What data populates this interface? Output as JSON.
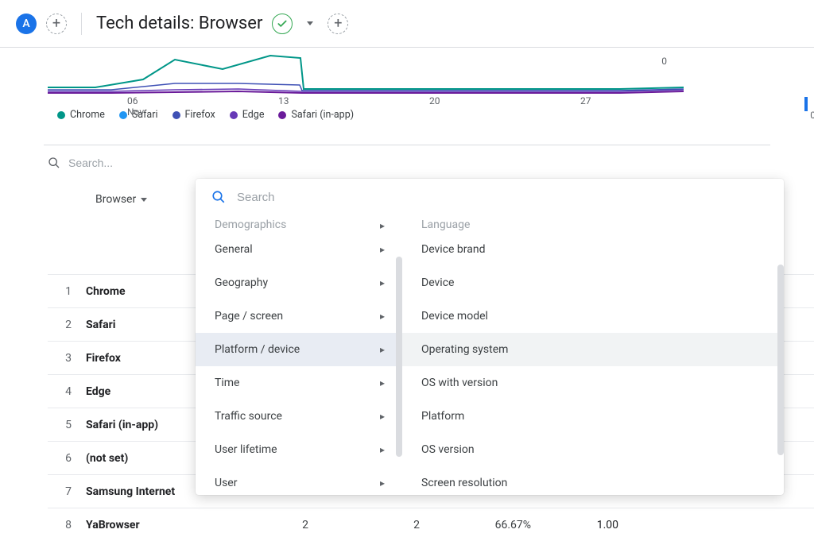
{
  "header": {
    "badge": "A",
    "title": "Tech details: Browser"
  },
  "chart": {
    "y0": "0",
    "y0_right": "0",
    "xticks": [
      "06",
      "13",
      "20",
      "27"
    ],
    "xsub": "Nov"
  },
  "legend": [
    {
      "label": "Chrome",
      "color": "#009688"
    },
    {
      "label": "Safari",
      "color": "#2196f3"
    },
    {
      "label": "Firefox",
      "color": "#3f51b5"
    },
    {
      "label": "Edge",
      "color": "#673ab7"
    },
    {
      "label": "Safari (in-app)",
      "color": "#6a1b9a"
    }
  ],
  "search_placeholder": "Search...",
  "dimension_label": "Browser",
  "table": {
    "rows": [
      {
        "idx": "1",
        "name": "Chrome"
      },
      {
        "idx": "2",
        "name": "Safari"
      },
      {
        "idx": "3",
        "name": "Firefox"
      },
      {
        "idx": "4",
        "name": "Edge"
      },
      {
        "idx": "5",
        "name": "Safari (in-app)"
      },
      {
        "idx": "6",
        "name": "(not set)"
      },
      {
        "idx": "7",
        "name": "Samsung Internet"
      },
      {
        "idx": "8",
        "name": "YaBrowser",
        "c1": "2",
        "c2": "2",
        "pct": "66.67%",
        "c3": "1.00"
      }
    ]
  },
  "dropdown": {
    "search_placeholder": "Search",
    "left": [
      {
        "label": "Demographics",
        "truncated": true
      },
      {
        "label": "General"
      },
      {
        "label": "Geography"
      },
      {
        "label": "Page / screen"
      },
      {
        "label": "Platform / device",
        "selected": true
      },
      {
        "label": "Time"
      },
      {
        "label": "Traffic source"
      },
      {
        "label": "User lifetime"
      },
      {
        "label": "User"
      }
    ],
    "right": [
      {
        "label": "Language",
        "truncated": true
      },
      {
        "label": "Device brand"
      },
      {
        "label": "Device"
      },
      {
        "label": "Device model"
      },
      {
        "label": "Operating system",
        "hover": true
      },
      {
        "label": "OS with version"
      },
      {
        "label": "Platform"
      },
      {
        "label": "OS version"
      },
      {
        "label": "Screen resolution"
      }
    ]
  }
}
